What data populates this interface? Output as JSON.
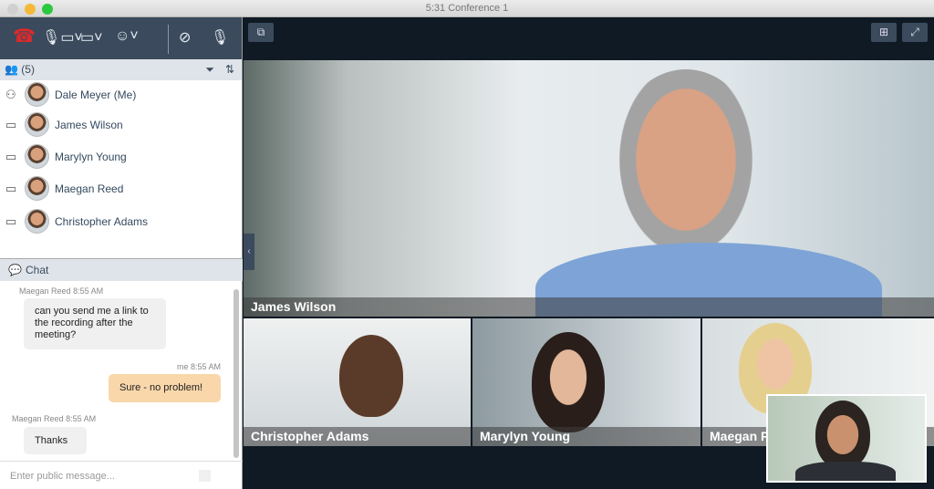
{
  "window": {
    "title": "5:31  Conference 1"
  },
  "toolbar": {
    "hangup": "hangup-icon",
    "mic_camera": "mic-camera-icon",
    "screen": "screen-share-icon",
    "participant": "participant-icon",
    "camera_off": "camera-off-icon",
    "mic_off": "mic-off-icon"
  },
  "participants": {
    "count": "(5)",
    "items": [
      {
        "name": "Dale Meyer (Me)",
        "icon": "person-icon"
      },
      {
        "name": "James Wilson",
        "icon": "monitor-icon"
      },
      {
        "name": "Marylyn Young",
        "icon": "monitor-icon"
      },
      {
        "name": "Maegan Reed",
        "icon": "monitor-icon"
      },
      {
        "name": "Christopher Adams",
        "icon": "monitor-icon"
      }
    ]
  },
  "chat": {
    "title": "Chat",
    "placeholder": "Enter public message...",
    "messages": [
      {
        "sender": "Maegan Reed",
        "time": "8:55 AM",
        "text": "can you send me a link to the recording after the meeting?"
      },
      {
        "sender": "me",
        "time": "8:55 AM",
        "text": "Sure - no problem!"
      },
      {
        "sender": "Maegan Reed",
        "time": "8:55 AM",
        "text": "Thanks"
      }
    ]
  },
  "videos": {
    "main": "James Wilson",
    "thumbs": [
      "Christopher Adams",
      "Marylyn Young",
      "Maegan Reed"
    ]
  },
  "colors": {
    "toolbar": "#3b4b5d",
    "me_bubble": "#f9d7aa",
    "other_bubble": "#f0f0f0",
    "hangup": "#e0292b"
  }
}
